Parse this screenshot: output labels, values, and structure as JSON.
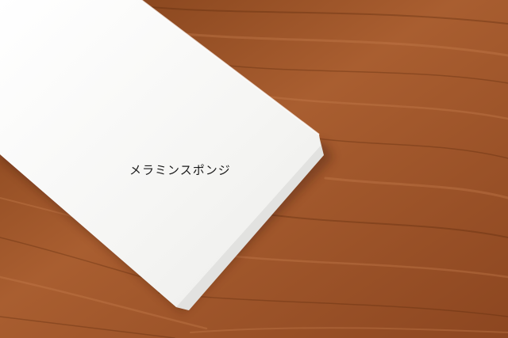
{
  "photo": {
    "subject": "melamine-sponge-block",
    "caption": "メラミンスポンジ",
    "colors": {
      "wood_light": "#b56a3a",
      "wood_mid": "#9a5428",
      "wood_dark": "#6e3512",
      "sponge_top": "#f6f6f4",
      "sponge_edge": "#e4e4e2"
    }
  }
}
